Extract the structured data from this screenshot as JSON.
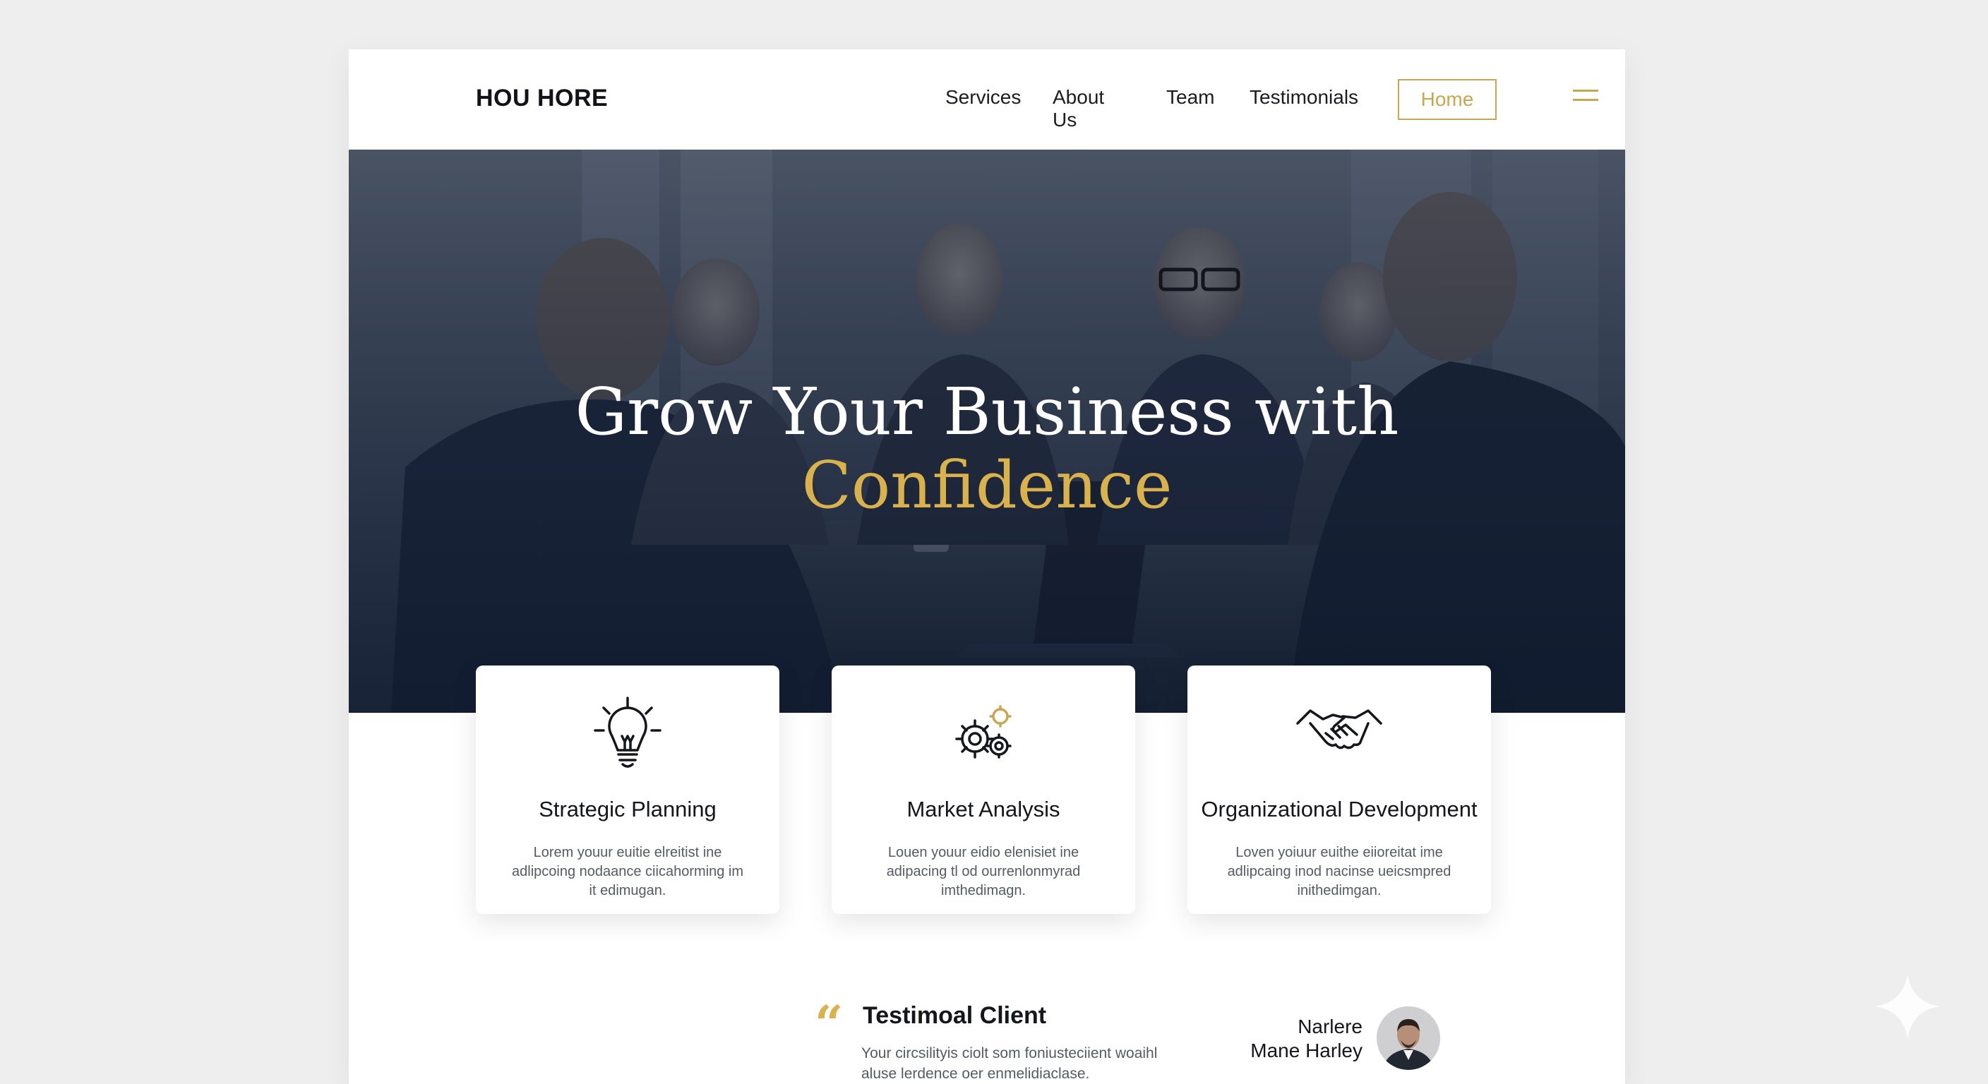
{
  "navbar": {
    "brand": "HOU HORE",
    "links": [
      "Services",
      "About Us",
      "Team",
      "Testimonials"
    ],
    "cta_label": "Home",
    "menu_icon": "hamburger-icon"
  },
  "hero": {
    "title_line1": "Grow Your Business with",
    "title_line2": "Confidence",
    "accent_color": "#d9b24d"
  },
  "cards": [
    {
      "icon": "lightbulb-icon",
      "title": "Strategic Planning",
      "text": "Lorem youur euitie elreitist ine adlipcoing nodaance ciicahorming im it edimugan."
    },
    {
      "icon": "gears-icon",
      "title": "Market Analysis",
      "text": "Louen youur eidio elenisiet ine adipacing tl od ourrenlonmyrad imthedimagn."
    },
    {
      "icon": "handshake-icon",
      "title": "Organizational Development",
      "text": "Loven yoiuur euithe eiioreitat ime adlipcaing inod nacinse ueicsmpred inithedimgan."
    }
  ],
  "testimonial": {
    "title": "Testimoal Client",
    "text": "Your circsilityis ciolt som foniusteciient woaihl aluse lerdence oer enmelidiaclase.",
    "client_name_line1": "Narlere",
    "client_name_line2": "Mane Harley",
    "avatar_icon": "client-avatar"
  },
  "colors": {
    "gold": "#c9a650",
    "dark_text": "#14161b",
    "background": "#eeeeef"
  }
}
